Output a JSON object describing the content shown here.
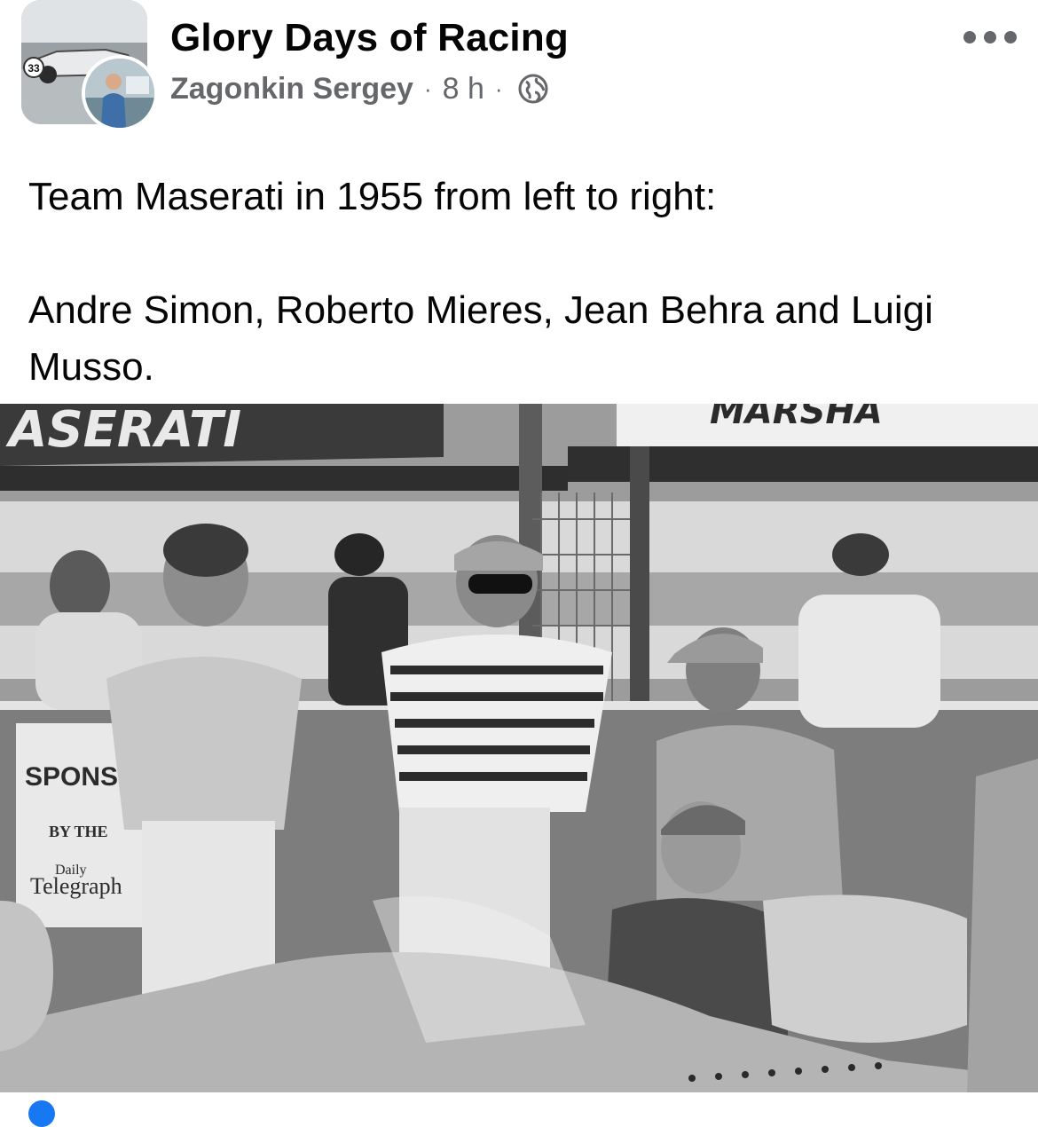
{
  "post": {
    "group_name": "Glory Days of Racing",
    "author_name": "Zagonkin Sergey",
    "dot": "·",
    "time": "8 h",
    "audience_icon": "globe-icon",
    "more_icon": "more-options-icon",
    "text_line_1": "Team Maserati in 1955 from left to right:",
    "text_line_2": "Andre Simon, Roberto Mieres, Jean Behra and Luigi Musso."
  },
  "photo": {
    "sign_left": "ASERATI",
    "sign_right": "MARSHA",
    "board_text_1": "SPONSOR",
    "board_text_2": "BY THE",
    "board_text_3": "Daily",
    "board_text_4": "Telegraph",
    "group_avatar_car_number": "33"
  },
  "colors": {
    "text_primary": "#050505",
    "text_secondary": "#65676b",
    "background": "#ffffff"
  }
}
